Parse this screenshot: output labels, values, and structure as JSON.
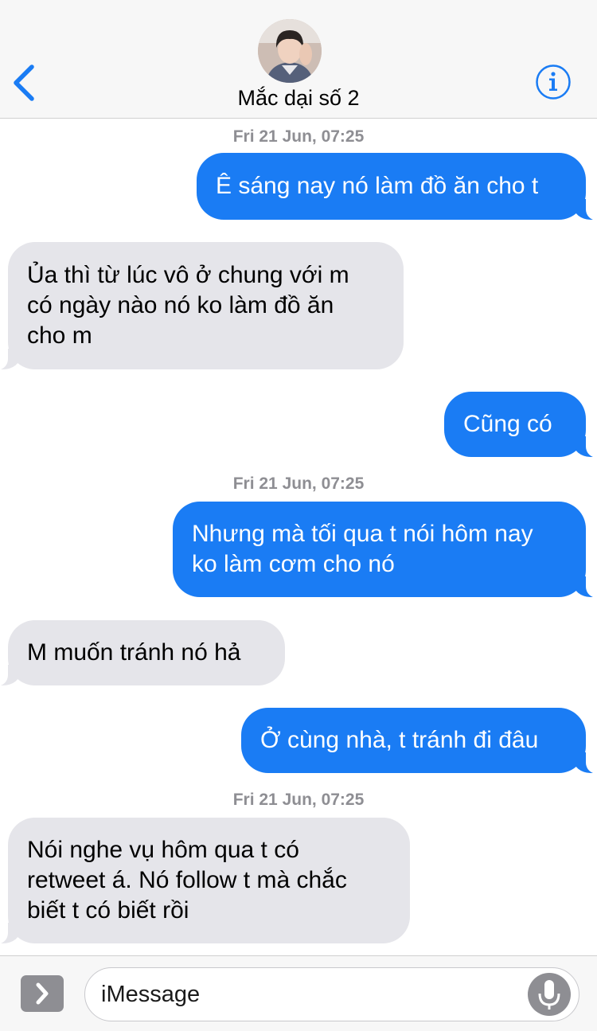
{
  "header": {
    "back_icon": "chevron-left-icon",
    "contact_name": "Mắc dại số 2",
    "info_icon": "info-icon",
    "accent_color": "#1a7cf4"
  },
  "messages": [
    {
      "type": "timestamp",
      "text": "Fri 21 Jun, 07:25"
    },
    {
      "type": "outgoing",
      "text": "Ê sáng nay nó làm đồ ăn cho t"
    },
    {
      "type": "incoming",
      "lines": [
        "Ủa thì từ lúc vô ở chung với m",
        "có ngày nào nó ko làm đồ ăn",
        "cho m"
      ]
    },
    {
      "type": "outgoing",
      "text": "Cũng có"
    },
    {
      "type": "timestamp",
      "text": "Fri 21 Jun, 07:25"
    },
    {
      "type": "outgoing",
      "lines": [
        "Nhưng mà tối qua t nói hôm nay",
        "ko làm cơm cho nó"
      ]
    },
    {
      "type": "incoming",
      "text": "M muốn tránh nó hả"
    },
    {
      "type": "outgoing",
      "text": "Ở cùng nhà, t tránh đi đâu"
    },
    {
      "type": "timestamp",
      "text": "Fri 21 Jun, 07:25"
    },
    {
      "type": "incoming",
      "lines": [
        "Nói nghe vụ hôm qua t có",
        "retweet á. Nó follow t mà chắc",
        "biết t có biết rồi"
      ]
    }
  ],
  "composer": {
    "apps_icon": "chevron-right-icon",
    "placeholder": "iMessage",
    "mic_icon": "microphone-icon"
  },
  "colors": {
    "outgoing_bubble": "#1a7cf4",
    "incoming_bubble": "#e5e5ea",
    "timestamp_text": "#8e8e93"
  }
}
